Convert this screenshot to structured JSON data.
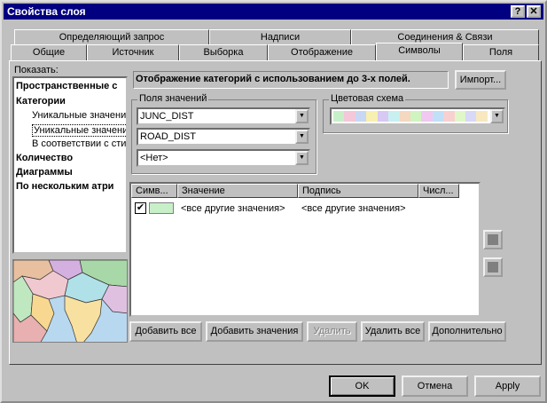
{
  "window": {
    "title": "Свойства слоя",
    "help_btn": "?",
    "close_btn": "✕"
  },
  "tabs_row1": [
    "Определяющий запрос",
    "Надписи",
    "Соединения & Связи"
  ],
  "tabs_row2": [
    "Общие",
    "Источник",
    "Выборка",
    "Отображение",
    "Символы",
    "Поля"
  ],
  "show": {
    "label": "Показать:",
    "items": [
      {
        "label": "Пространственные с",
        "bold": true
      },
      {
        "label": "Категории",
        "bold": true
      },
      {
        "label": "Уникальные значени",
        "bold": false
      },
      {
        "label": "Уникальные значени",
        "bold": false
      },
      {
        "label": "В соответствии с сти",
        "bold": false
      },
      {
        "label": "Количество",
        "bold": true
      },
      {
        "label": "Диаграммы",
        "bold": true
      },
      {
        "label": "По нескольким атри",
        "bold": true
      }
    ]
  },
  "header": {
    "text": "Отображение категорий с использованием до 3-х полей.",
    "import_btn": "Импорт..."
  },
  "value_fields": {
    "title": "Поля значений",
    "field1": "JUNC_DIST",
    "field2": "ROAD_DIST",
    "field3": "<Нет>"
  },
  "color_scheme": {
    "title": "Цветовая схема",
    "colors": [
      "#c8f0c8",
      "#f4c8d8",
      "#c8d8f4",
      "#f8f0b0",
      "#d8c8f4",
      "#c8f0f0",
      "#f4d8c0",
      "#d0f4c0",
      "#f0c8f0",
      "#c0e0f8",
      "#f8d0d0",
      "#e0f8c8",
      "#d8d8f8",
      "#f8e8c0"
    ]
  },
  "table": {
    "headers": [
      "Симв...",
      "Значение",
      "Подпись",
      "Числ..."
    ],
    "rows": [
      {
        "value": "<все другие значения>",
        "label": "<все другие значения>",
        "count": "",
        "symbol_color": "#c8f0c8"
      }
    ]
  },
  "buttons": {
    "add_all": "Добавить все",
    "add_values": "Добавить значения",
    "remove": "Удалить",
    "remove_all": "Удалить все",
    "advanced": "Дополнительно",
    "ok": "OK",
    "cancel": "Отмена",
    "apply": "Apply"
  }
}
